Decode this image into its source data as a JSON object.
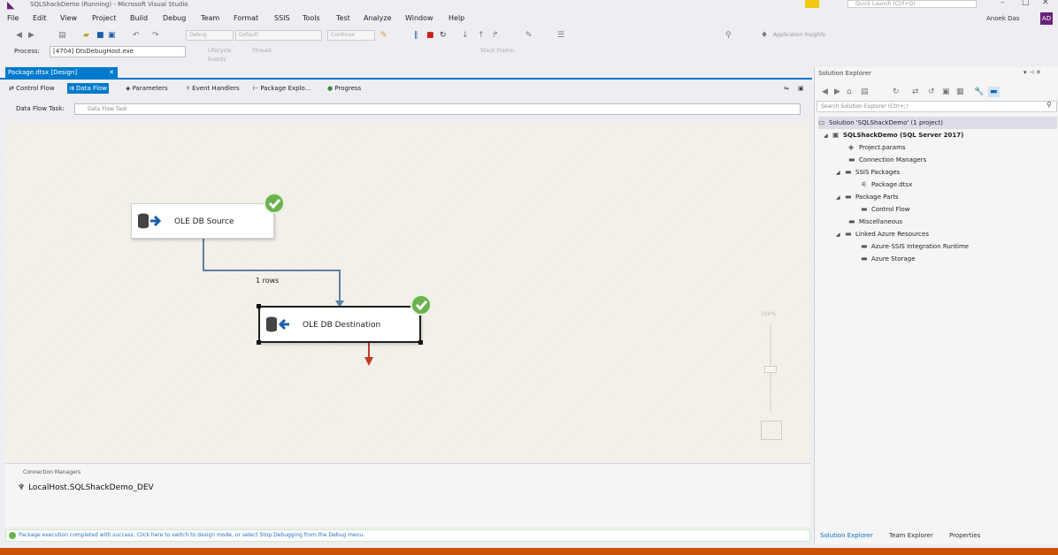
{
  "window": {
    "title": "SQLShackDemo (Running) - Microsoft Visual Studio",
    "quick_launch_placeholder": "Quick Launch (Ctrl+Q)",
    "controls": [
      "–",
      "□",
      "✕"
    ]
  },
  "menu": {
    "items": [
      "File",
      "Edit",
      "View",
      "Project",
      "Build",
      "Debug",
      "Team",
      "Format",
      "SSIS",
      "Tools",
      "Test",
      "Analyze",
      "Window",
      "Help"
    ],
    "user": "Anoek Das",
    "avatar": "AD"
  },
  "toolbar": {
    "combos": [
      "Debug",
      "Default",
      "Continue"
    ],
    "app_insights": "Application Insights"
  },
  "debug_bar": {
    "process_label": "Process:",
    "process_value": "[4704] DtsDebugHost.exe",
    "lifecycle": "Lifecycle Events",
    "thread": "Thread:",
    "stack_frame": "Stack Frame:"
  },
  "document_tab": {
    "label": "Package.dtsx [Design]",
    "close": "✕"
  },
  "designer_tabs": [
    {
      "label": "Control Flow",
      "icon": "control-flow-icon",
      "active": false
    },
    {
      "label": "Data Flow",
      "icon": "data-flow-icon",
      "active": true
    },
    {
      "label": "Parameters",
      "icon": "parameters-icon",
      "active": false
    },
    {
      "label": "Event Handlers",
      "icon": "event-handlers-icon",
      "active": false
    },
    {
      "label": "Package Explo...",
      "icon": "package-explorer-icon",
      "active": false
    },
    {
      "label": "Progress",
      "icon": "progress-icon",
      "active": false
    }
  ],
  "data_flow_task": {
    "label": "Data Flow Task:",
    "value": "Data Flow Task"
  },
  "canvas": {
    "source": {
      "label": "OLE DB Source",
      "status": "success"
    },
    "destination": {
      "label": "OLE DB Destination",
      "status": "success"
    },
    "path_label": "1 rows"
  },
  "connection_managers": {
    "header": "Connection Managers",
    "items": [
      "LocalHost.SQLShackDemo_DEV"
    ]
  },
  "status_message": "Package execution completed with success. Click here to switch to design mode, or select Stop Debugging from the Debug menu.",
  "solution_explorer": {
    "title": "Solution Explorer",
    "search_placeholder": "Search Solution Explorer (Ctrl+;)",
    "tree": [
      {
        "label": "Solution 'SQLShackDemo' (1 project)",
        "depth": 0,
        "icon": "solution-icon",
        "selected": true
      },
      {
        "label": "SQLShackDemo (SQL Server 2017)",
        "depth": 1,
        "icon": "project-icon",
        "bold": true
      },
      {
        "label": "Project.params",
        "depth": 2,
        "icon": "params-icon"
      },
      {
        "label": "Connection Managers",
        "depth": 2,
        "icon": "folder-icon"
      },
      {
        "label": "SSIS Packages",
        "depth": 2,
        "icon": "folder-icon",
        "expanded": true
      },
      {
        "label": "Package.dtsx",
        "depth": 3,
        "icon": "package-icon"
      },
      {
        "label": "Package Parts",
        "depth": 2,
        "icon": "folder-icon",
        "expanded": true
      },
      {
        "label": "Control Flow",
        "depth": 3,
        "icon": "folder-icon"
      },
      {
        "label": "Miscellaneous",
        "depth": 2,
        "icon": "folder-icon"
      },
      {
        "label": "Linked Azure Resources",
        "depth": 2,
        "icon": "folder-icon",
        "expanded": true
      },
      {
        "label": "Azure-SSIS Integration Runtime",
        "depth": 3,
        "icon": "folder-icon"
      },
      {
        "label": "Azure Storage",
        "depth": 3,
        "icon": "folder-icon"
      }
    ],
    "bottom_tabs": [
      "Solution Explorer",
      "Team Explorer",
      "Properties"
    ]
  },
  "zoom": {
    "level": "100%"
  },
  "colors": {
    "accent": "#007acc",
    "statusbar": "#ca5100",
    "success": "#6bb24c",
    "brand": "#68217a"
  }
}
